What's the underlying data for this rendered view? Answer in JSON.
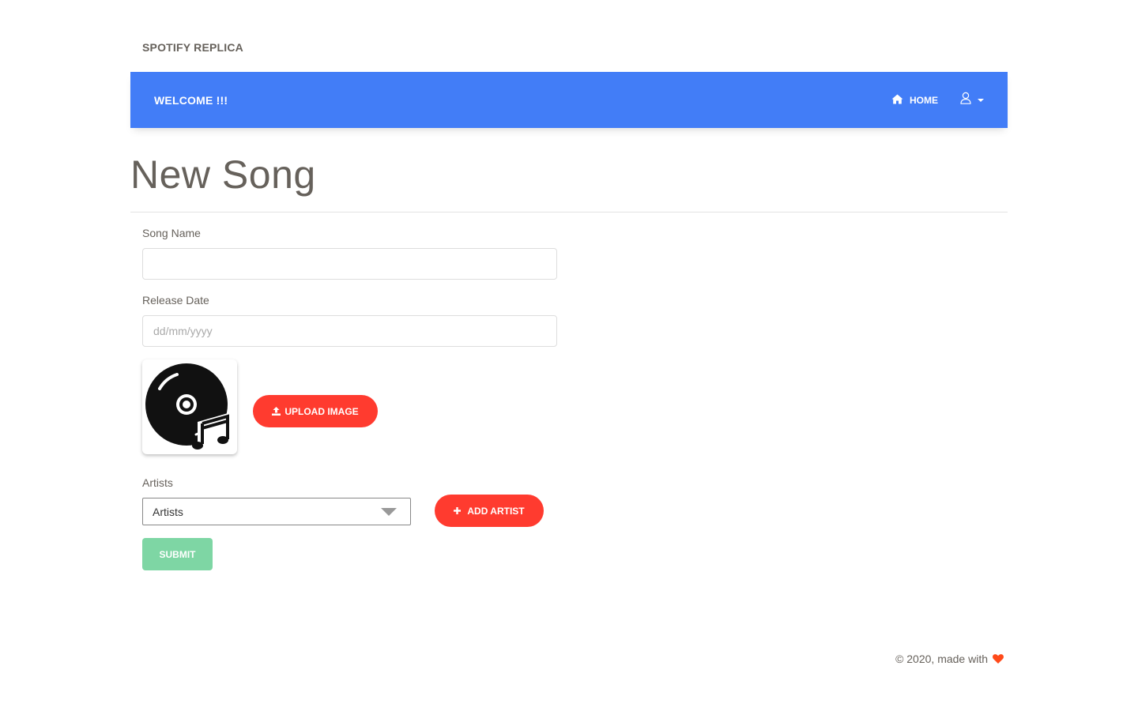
{
  "brand": "SPOTIFY REPLICA",
  "navbar": {
    "welcome": "WELCOME !!!",
    "home_label": "HOME",
    "accent_color": "#427df7"
  },
  "page": {
    "title": "New Song"
  },
  "form": {
    "song_name_label": "Song Name",
    "song_name_value": "",
    "release_date_label": "Release Date",
    "release_date_placeholder": "dd/mm/yyyy",
    "upload_button": "UPLOAD IMAGE",
    "artists_label": "Artists",
    "artists_select_value": "Artists",
    "add_artist_button": "ADD ARTIST",
    "submit_button": "SUBMIT"
  },
  "footer": {
    "text": "© 2020, made with"
  },
  "colors": {
    "danger": "#ff3b2f",
    "success": "#7ed6a4",
    "heart": "#ff4a1a"
  }
}
